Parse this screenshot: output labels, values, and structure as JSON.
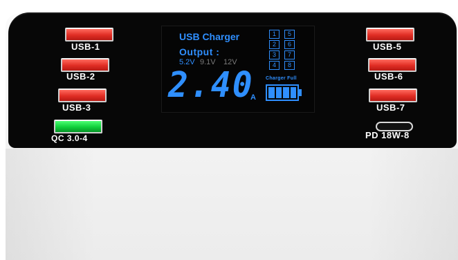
{
  "ports_left": [
    {
      "label": "USB-1",
      "type": "usb-a"
    },
    {
      "label": "USB-2",
      "type": "usb-a"
    },
    {
      "label": "USB-3",
      "type": "usb-a"
    },
    {
      "label": "QC 3.0-4",
      "type": "usb-a-qc"
    }
  ],
  "ports_right": [
    {
      "label": "USB-5",
      "type": "usb-a"
    },
    {
      "label": "USB-6",
      "type": "usb-a"
    },
    {
      "label": "USB-7",
      "type": "usb-a"
    },
    {
      "label": "PD 18W-8",
      "type": "usb-c"
    }
  ],
  "display": {
    "title": "USB Charger",
    "output_label": "Output :",
    "voltages": [
      "5.2V",
      "9.1V",
      "12V"
    ],
    "active_voltage": "5.2V",
    "reading": "2.40",
    "unit": "A",
    "port_numbers": [
      "1",
      "5",
      "2",
      "6",
      "3",
      "7",
      "4",
      "8"
    ],
    "charger_full": "Charger Full",
    "battery_level": 1.0
  },
  "colors": {
    "lcd_blue": "#2f8fff",
    "usb_red": "#e02d24",
    "qc_green": "#0fcf3a",
    "panel_black": "#070707",
    "housing_white": "#f4f4f4"
  }
}
